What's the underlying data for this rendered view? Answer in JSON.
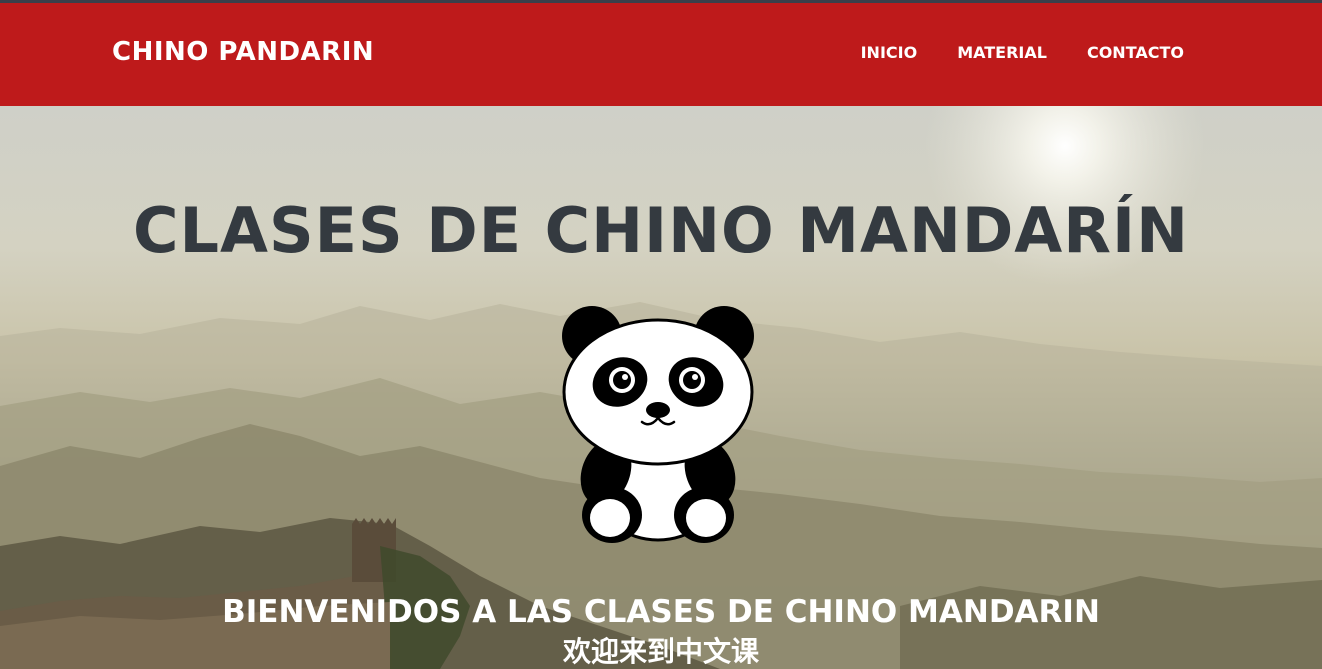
{
  "navbar": {
    "brand": "CHINO PANDARIN",
    "links": [
      {
        "label": "INICIO"
      },
      {
        "label": "MATERIAL"
      },
      {
        "label": "CONTACTO"
      }
    ],
    "background_color": "#be1a1b"
  },
  "hero": {
    "title": "CLASES DE CHINO MANDARÍN",
    "welcome": "BIENVENIDOS A LAS CLASES DE CHINO MANDARIN",
    "welcome_chinese": "欢迎来到中文课",
    "title_color": "#343a40",
    "image": "great-wall-landscape",
    "mascot_icon": "panda-icon"
  }
}
